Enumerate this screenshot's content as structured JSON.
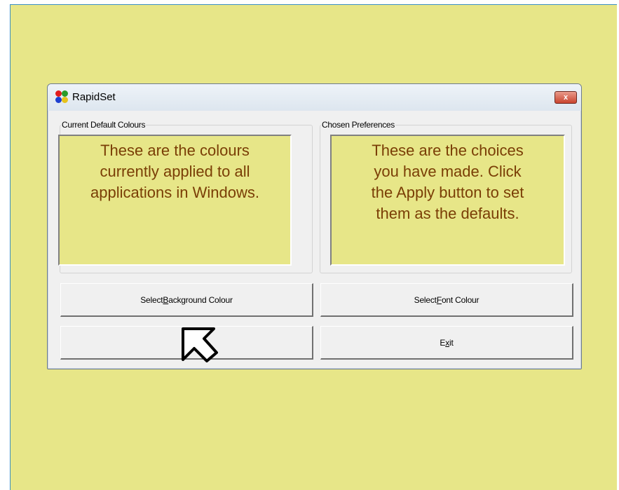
{
  "window": {
    "title": "RapidSet",
    "close_glyph": "x"
  },
  "groups": {
    "current": {
      "legend": "Current Default Colours",
      "lines": [
        "These are the colours",
        "currently applied to all",
        "applications in Windows."
      ]
    },
    "chosen": {
      "legend": "Chosen Preferences",
      "lines": [
        "These are the choices",
        "you have made.  Click",
        "the Apply button to set",
        "them as the defaults."
      ]
    }
  },
  "buttons": {
    "background": {
      "pre": "Select ",
      "accel": "B",
      "post": "ackground Colour"
    },
    "font": {
      "pre": "Select ",
      "accel": "F",
      "post": "ont Colour"
    },
    "apply": {
      "pre": "",
      "accel": "A",
      "post": ""
    },
    "exit": {
      "pre": "E",
      "accel": "x",
      "post": "it"
    }
  },
  "colors": {
    "preview_background": "#e7e688",
    "preview_text": "#7a3e06",
    "desktop": "#e7e688"
  },
  "icons": {
    "app": "rapidset-app-icon",
    "close": "close-icon",
    "cursor": "mouse-cursor-icon"
  }
}
